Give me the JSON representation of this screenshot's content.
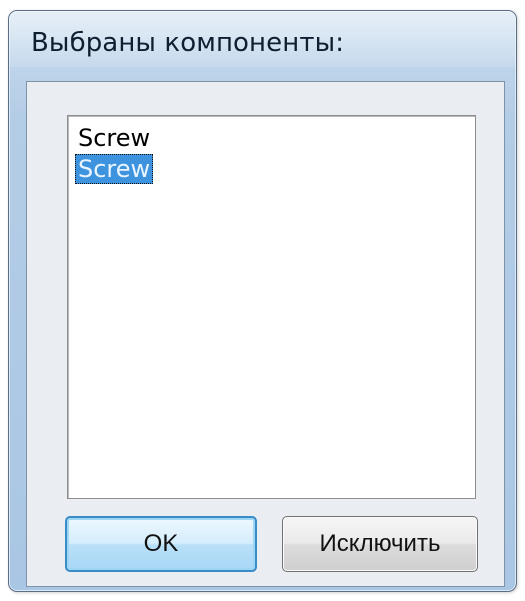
{
  "window": {
    "title": "Выбраны компоненты:"
  },
  "list": {
    "items": [
      {
        "label": "Screw",
        "selected": false
      },
      {
        "label": "Screw",
        "selected": true
      }
    ]
  },
  "buttons": {
    "ok_label": "OK",
    "exclude_label": "Исключить"
  },
  "colors": {
    "selection_background": "#3d93de",
    "default_button_border": "#3a8cc6"
  }
}
